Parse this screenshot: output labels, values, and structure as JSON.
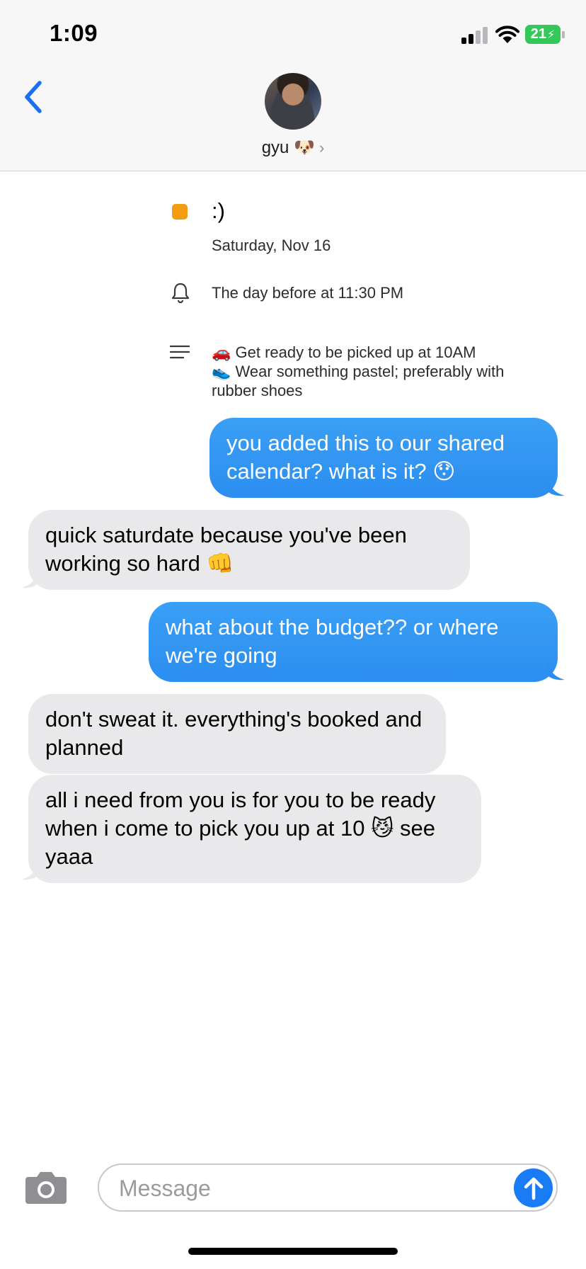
{
  "status_bar": {
    "time": "1:09",
    "battery": "21",
    "battery_color": "#34c759"
  },
  "header": {
    "back_icon": "chevron-left-icon",
    "contact_name": "gyu 🐶",
    "contact_chevron": "›"
  },
  "event": {
    "color": "#f39c12",
    "title": ":)",
    "date": "Saturday, Nov 16",
    "alert": "The day before at 11:30 PM",
    "notes_line1": "🚗 Get ready to be picked up at 10AM",
    "notes_line2": "👟 Wear something pastel; preferably with rubber shoes"
  },
  "messages": [
    {
      "direction": "outgoing",
      "text": "you added this to our shared calendar? what is it? 😯"
    },
    {
      "direction": "incoming",
      "text": "quick saturdate because you've been working so hard 👊"
    },
    {
      "direction": "outgoing",
      "text": "what about the budget?? or where we're going"
    },
    {
      "direction": "incoming",
      "text": "don't sweat it. everything's booked and planned"
    },
    {
      "direction": "incoming",
      "text": "all i need from you is for you to be ready when i come to pick you up at 10 😼 see yaaa"
    }
  ],
  "composer": {
    "placeholder": "Message",
    "camera_icon": "camera-icon",
    "send_icon": "arrow-up-icon",
    "send_color": "#1a7cf5"
  },
  "colors": {
    "outgoing_bubble": "#2b8ef0",
    "incoming_bubble": "#e9e9eb",
    "accent": "#1a7cf5"
  }
}
